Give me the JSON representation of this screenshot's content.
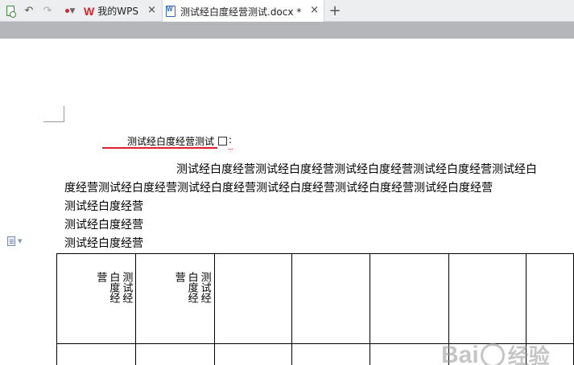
{
  "tabs": {
    "wps_logo": "W",
    "wps_label": "我的WPS",
    "doc_label": "测试经白度经营测试.docx *",
    "close_glyph": "×",
    "add_glyph": "+"
  },
  "quick_access": {
    "undo_glyph": "↶",
    "redo_glyph": "↷"
  },
  "document": {
    "title": "测试经白度经营测试",
    "title_colon": ":",
    "para_line1": "测试经白度经营测试经白度经营测试经白度经营测试经白度经营测试经白",
    "para_line2": "度经营测试经白度经营测试经白度经营测试经白度经营测试经白度经营测试经白度经营",
    "line3": "测试经白度经营",
    "line4": "测试经白度经营",
    "line5": "测试经白度经营"
  },
  "table": {
    "cell_r1c1": "测试经白度经营",
    "cell_r1c2": "测试经白度经营"
  },
  "watermark": {
    "text_left": "Bai",
    "text_right": "经验"
  },
  "colors": {
    "accent_red": "#e0202a",
    "wps_red": "#d9232d",
    "word_blue": "#2b66b8"
  }
}
